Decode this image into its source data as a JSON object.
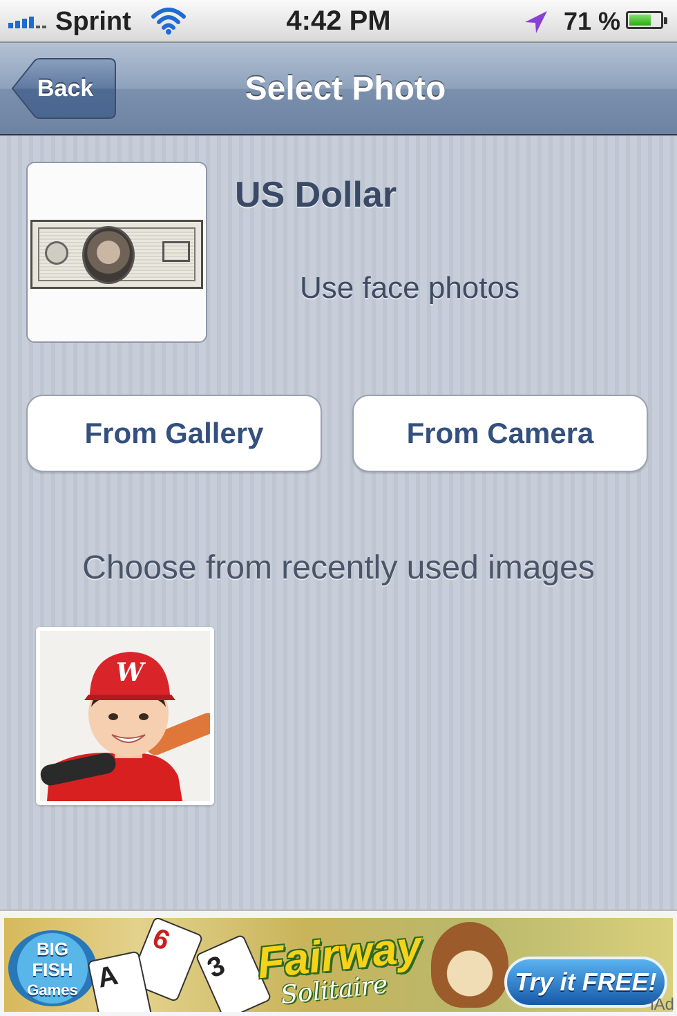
{
  "status_bar": {
    "carrier": "Sprint",
    "time": "4:42 PM",
    "battery_percent": "71 %",
    "battery_level": 0.71,
    "icons": [
      "signal-icon",
      "wifi-icon",
      "location-arrow-icon",
      "battery-icon"
    ]
  },
  "nav_bar": {
    "back_label": "Back",
    "title": "Select Photo"
  },
  "template": {
    "name": "US Dollar",
    "hint": "Use face photos"
  },
  "actions": {
    "gallery_label": "From Gallery",
    "camera_label": "From Camera"
  },
  "recent": {
    "label": "Choose from recently used images",
    "cap_letter": "W"
  },
  "ad": {
    "logo_line1": "BIG",
    "logo_line2": "FISH",
    "logo_line3": "Games",
    "cards": [
      "6",
      "3",
      "A"
    ],
    "title": "Fairway",
    "subtitle": "Solitaire",
    "cta_label": "Try it FREE!",
    "network": "iAd"
  },
  "colors": {
    "nav_bar": "#7b90ad",
    "button_text": "#34507e",
    "background": "#c5ccd7"
  }
}
